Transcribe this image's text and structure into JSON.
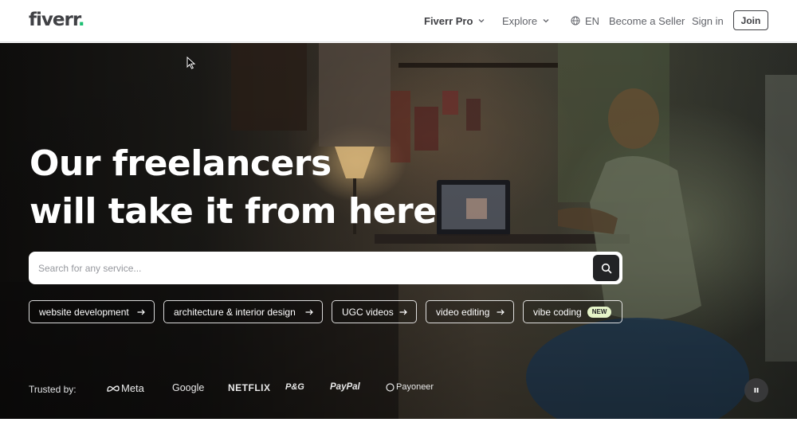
{
  "header": {
    "logo": {
      "text": "fiverr",
      "dot": "."
    },
    "nav": {
      "pro": "Fiverr Pro",
      "explore": "Explore",
      "language": "EN",
      "become_seller": "Become a Seller",
      "sign_in": "Sign in",
      "join": "Join"
    }
  },
  "hero": {
    "title_line1": "Our freelancers",
    "title_line2": "will take it from here",
    "search": {
      "placeholder": "Search for any service...",
      "value": ""
    },
    "chips": [
      {
        "label": "website development"
      },
      {
        "label": "architecture & interior design"
      },
      {
        "label": "UGC videos"
      },
      {
        "label": "video editing"
      },
      {
        "label": "vibe coding",
        "badge": "NEW"
      }
    ],
    "trusted_label": "Trusted by:",
    "brands": [
      "Meta",
      "Google",
      "NETFLIX",
      "P&G",
      "PayPal",
      "Payoneer"
    ]
  },
  "colors": {
    "brand_green": "#1dbf73",
    "text_dark": "#404145",
    "badge_bg": "#e6f5c9",
    "search_button": "#222325"
  },
  "icons": [
    "chevron-down-icon",
    "globe-icon",
    "search-icon",
    "arrow-right-icon",
    "pause-icon",
    "meta-logo-icon",
    "payoneer-logo-icon",
    "mouse-cursor-icon"
  ]
}
